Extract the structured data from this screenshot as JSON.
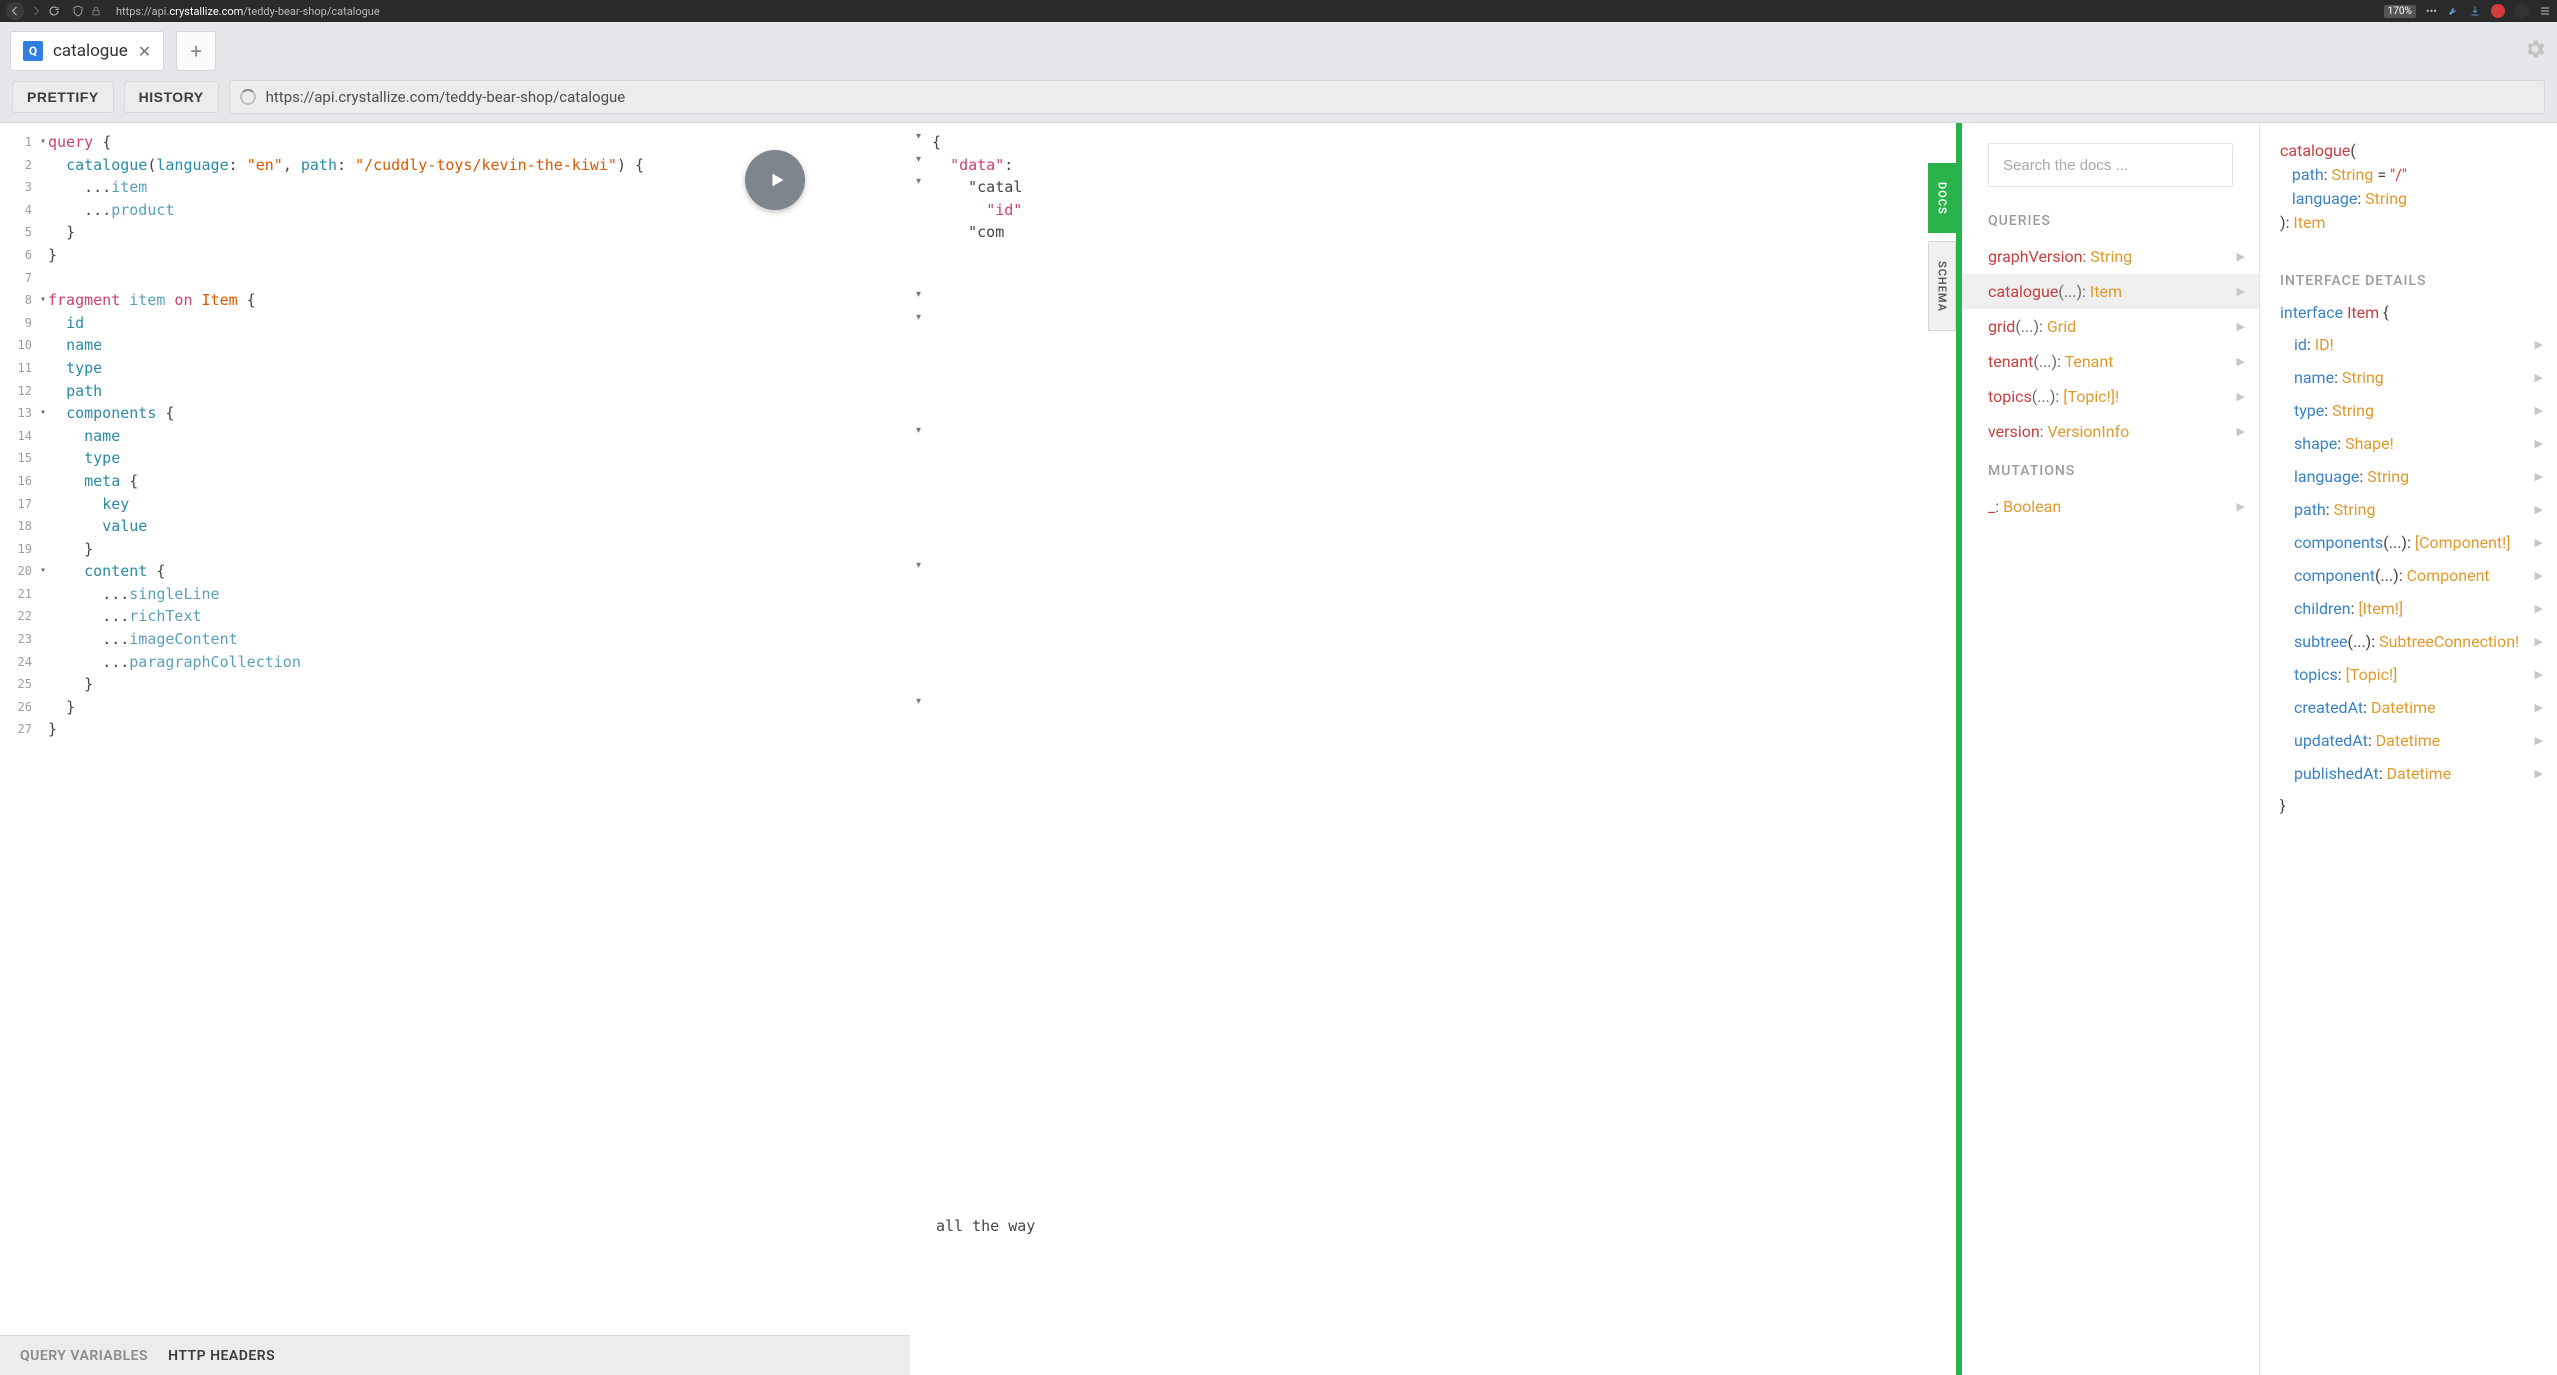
{
  "browser": {
    "url_prefix": "https://api.",
    "url_bold": "crystallize.com",
    "url_suffix": "/teddy-bear-shop/catalogue",
    "zoom": "170%"
  },
  "tab": {
    "title": "catalogue",
    "icon_letter": "Q"
  },
  "toolbar": {
    "prettify": "PRETTIFY",
    "history": "HISTORY",
    "url": "https://api.crystallize.com/teddy-bear-shop/catalogue"
  },
  "editor_lines": [
    {
      "n": "1",
      "fold": true,
      "indent": 0,
      "segs": [
        {
          "t": "query ",
          "c": "kw"
        },
        {
          "t": "{",
          "c": "plain"
        }
      ]
    },
    {
      "n": "2",
      "indent": 1,
      "segs": [
        {
          "t": "catalogue",
          "c": "fld"
        },
        {
          "t": "(",
          "c": "plain"
        },
        {
          "t": "language",
          "c": "fld"
        },
        {
          "t": ": ",
          "c": "plain"
        },
        {
          "t": "\"en\"",
          "c": "str"
        },
        {
          "t": ", ",
          "c": "plain"
        },
        {
          "t": "path",
          "c": "fld"
        },
        {
          "t": ": ",
          "c": "plain"
        },
        {
          "t": "\"/cuddly-toys/kevin-the-kiwi\"",
          "c": "str"
        },
        {
          "t": ") {",
          "c": "plain"
        }
      ]
    },
    {
      "n": "3",
      "indent": 2,
      "segs": [
        {
          "t": "...",
          "c": "plain"
        },
        {
          "t": "item",
          "c": "frag"
        }
      ]
    },
    {
      "n": "4",
      "indent": 2,
      "segs": [
        {
          "t": "...",
          "c": "plain"
        },
        {
          "t": "product",
          "c": "frag"
        }
      ]
    },
    {
      "n": "5",
      "indent": 1,
      "segs": [
        {
          "t": "}",
          "c": "plain"
        }
      ]
    },
    {
      "n": "6",
      "indent": 0,
      "segs": [
        {
          "t": "}",
          "c": "plain"
        }
      ]
    },
    {
      "n": "7",
      "indent": 0,
      "segs": []
    },
    {
      "n": "8",
      "fold": true,
      "indent": 0,
      "segs": [
        {
          "t": "fragment ",
          "c": "kw"
        },
        {
          "t": "item",
          "c": "frag"
        },
        {
          "t": " on ",
          "c": "kw"
        },
        {
          "t": "Item",
          "c": "str"
        },
        {
          "t": " {",
          "c": "plain"
        }
      ]
    },
    {
      "n": "9",
      "indent": 1,
      "segs": [
        {
          "t": "id",
          "c": "fld"
        }
      ]
    },
    {
      "n": "10",
      "indent": 1,
      "segs": [
        {
          "t": "name",
          "c": "fld"
        }
      ]
    },
    {
      "n": "11",
      "indent": 1,
      "segs": [
        {
          "t": "type",
          "c": "fld"
        }
      ]
    },
    {
      "n": "12",
      "indent": 1,
      "segs": [
        {
          "t": "path",
          "c": "fld"
        }
      ]
    },
    {
      "n": "13",
      "fold": true,
      "indent": 1,
      "segs": [
        {
          "t": "components",
          "c": "fld"
        },
        {
          "t": " {",
          "c": "plain"
        }
      ]
    },
    {
      "n": "14",
      "indent": 2,
      "segs": [
        {
          "t": "name",
          "c": "fld"
        }
      ]
    },
    {
      "n": "15",
      "indent": 2,
      "segs": [
        {
          "t": "type",
          "c": "fld"
        }
      ]
    },
    {
      "n": "16",
      "indent": 2,
      "segs": [
        {
          "t": "meta",
          "c": "fld"
        },
        {
          "t": " {",
          "c": "plain"
        }
      ]
    },
    {
      "n": "17",
      "indent": 3,
      "segs": [
        {
          "t": "key",
          "c": "fld"
        }
      ]
    },
    {
      "n": "18",
      "indent": 3,
      "segs": [
        {
          "t": "value",
          "c": "fld"
        }
      ]
    },
    {
      "n": "19",
      "indent": 2,
      "segs": [
        {
          "t": "}",
          "c": "plain"
        }
      ]
    },
    {
      "n": "20",
      "fold": true,
      "indent": 2,
      "segs": [
        {
          "t": "content",
          "c": "fld"
        },
        {
          "t": " {",
          "c": "plain"
        }
      ]
    },
    {
      "n": "21",
      "indent": 3,
      "segs": [
        {
          "t": "...",
          "c": "plain"
        },
        {
          "t": "singleLine",
          "c": "frag"
        }
      ]
    },
    {
      "n": "22",
      "indent": 3,
      "segs": [
        {
          "t": "...",
          "c": "plain"
        },
        {
          "t": "richText",
          "c": "frag"
        }
      ]
    },
    {
      "n": "23",
      "indent": 3,
      "segs": [
        {
          "t": "...",
          "c": "plain"
        },
        {
          "t": "imageContent",
          "c": "frag"
        }
      ]
    },
    {
      "n": "24",
      "indent": 3,
      "segs": [
        {
          "t": "...",
          "c": "plain"
        },
        {
          "t": "paragraphCollection",
          "c": "frag"
        }
      ]
    },
    {
      "n": "25",
      "indent": 2,
      "segs": [
        {
          "t": "}",
          "c": "plain"
        }
      ]
    },
    {
      "n": "26",
      "indent": 1,
      "segs": [
        {
          "t": "}",
          "c": "plain"
        }
      ]
    },
    {
      "n": "27",
      "indent": 0,
      "segs": [
        {
          "t": "}",
          "c": "plain"
        }
      ]
    }
  ],
  "footer": {
    "variables": "QUERY VARIABLES",
    "headers": "HTTP HEADERS"
  },
  "results": {
    "lines": [
      "{",
      "  \"data\": ",
      "    \"catal",
      "      \"id\"",
      "",
      "",
      "",
      "    \"com"
    ],
    "arrows_at": [
      0,
      1,
      2,
      7,
      8,
      13,
      19,
      25
    ],
    "bottom_text": "all the way"
  },
  "side_tabs": {
    "docs": "DOCS",
    "schema": "SCHEMA"
  },
  "docs_left": {
    "search_placeholder": "Search the docs ...",
    "queries_hdr": "QUERIES",
    "mutations_hdr": "MUTATIONS",
    "queries": [
      {
        "name": "graphVersion",
        "args": "",
        "type": "String"
      },
      {
        "name": "catalogue",
        "args": "(...)",
        "type": "Item",
        "selected": true
      },
      {
        "name": "grid",
        "args": "(...)",
        "type": "Grid"
      },
      {
        "name": "tenant",
        "args": "(...)",
        "type": "Tenant"
      },
      {
        "name": "topics",
        "args": "(...)",
        "type": "[Topic!]!"
      },
      {
        "name": "version",
        "args": "",
        "type": "VersionInfo"
      }
    ],
    "mutations": [
      {
        "name": "_",
        "args": "",
        "type": "Boolean"
      }
    ]
  },
  "detail": {
    "name": "catalogue",
    "args": [
      {
        "name": "path",
        "type": "String",
        "default": "\"/\""
      },
      {
        "name": "language",
        "type": "String"
      }
    ],
    "ret": "Item",
    "interface_hdr": "INTERFACE DETAILS",
    "iface_kw": "interface",
    "iface_name": "Item",
    "fields": [
      {
        "name": "id",
        "args": "",
        "type": "ID!"
      },
      {
        "name": "name",
        "args": "",
        "type": "String"
      },
      {
        "name": "type",
        "args": "",
        "type": "String"
      },
      {
        "name": "shape",
        "args": "",
        "type": "Shape!"
      },
      {
        "name": "language",
        "args": "",
        "type": "String"
      },
      {
        "name": "path",
        "args": "",
        "type": "String"
      },
      {
        "name": "components",
        "args": "(...)",
        "type": "[Component!]"
      },
      {
        "name": "component",
        "args": "(...)",
        "type": "Component"
      },
      {
        "name": "children",
        "args": "",
        "type": "[Item!]"
      },
      {
        "name": "subtree",
        "args": "(...)",
        "type": "SubtreeConnection!"
      },
      {
        "name": "topics",
        "args": "",
        "type": "[Topic!]"
      },
      {
        "name": "createdAt",
        "args": "",
        "type": "Datetime"
      },
      {
        "name": "updatedAt",
        "args": "",
        "type": "Datetime"
      },
      {
        "name": "publishedAt",
        "args": "",
        "type": "Datetime"
      }
    ]
  }
}
